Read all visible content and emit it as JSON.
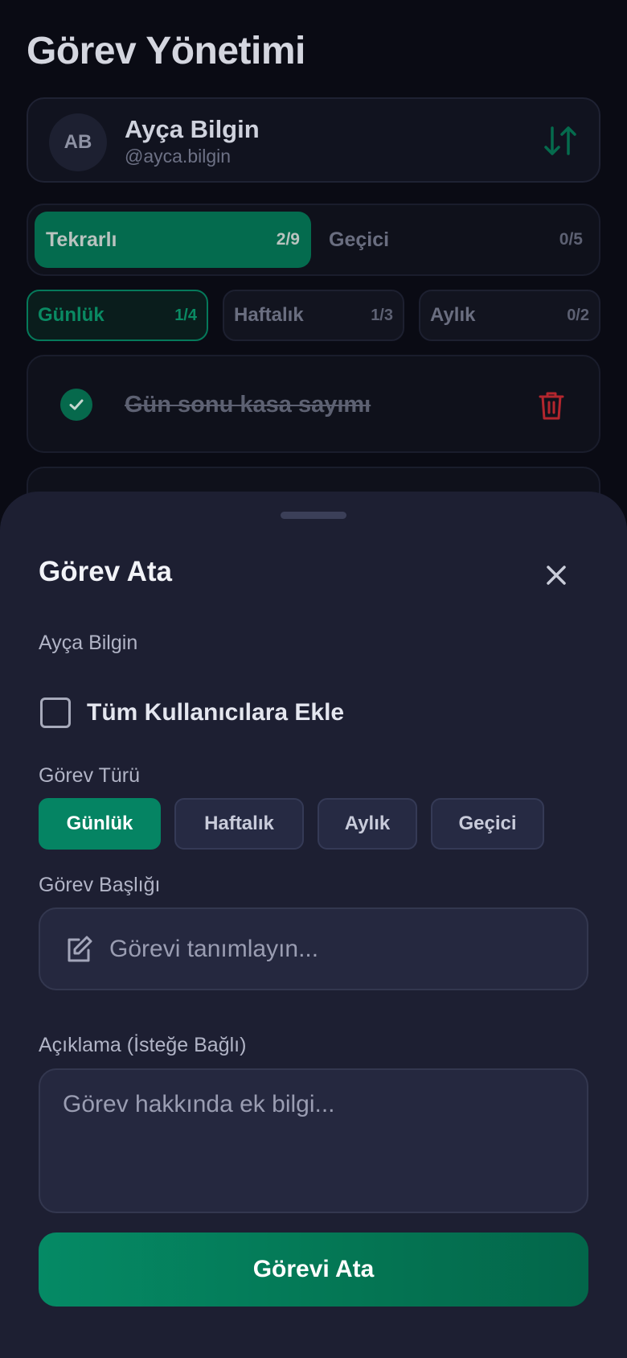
{
  "header": {
    "title": "Görev Yönetimi"
  },
  "user": {
    "initials": "AB",
    "name": "Ayça Bilgin",
    "handle": "@ayca.bilgin"
  },
  "segments": [
    {
      "label": "Tekrarlı",
      "count": "2/9",
      "active": true
    },
    {
      "label": "Geçici",
      "count": "0/5",
      "active": false
    }
  ],
  "frequency_tabs": [
    {
      "label": "Günlük",
      "count": "1/4",
      "active": true
    },
    {
      "label": "Haftalık",
      "count": "1/3",
      "active": false
    },
    {
      "label": "Aylık",
      "count": "0/2",
      "active": false
    }
  ],
  "tasks": [
    {
      "title": "Gün sonu kasa sayımı",
      "completed": true
    }
  ],
  "sheet": {
    "title": "Görev Ata",
    "assignee": "Ayça Bilgin",
    "all_users_label": "Tüm Kullanıcılara Ekle",
    "all_users_checked": false,
    "type_label": "Görev Türü",
    "types": [
      {
        "label": "Günlük",
        "selected": true
      },
      {
        "label": "Haftalık",
        "selected": false
      },
      {
        "label": "Aylık",
        "selected": false
      },
      {
        "label": "Geçici",
        "selected": false
      }
    ],
    "title_label": "Görev Başlığı",
    "title_placeholder": "Görevi tanımlayın...",
    "description_label": "Açıklama (İsteğe Bağlı)",
    "description_placeholder": "Görev hakkında ek bilgi...",
    "submit_label": "Görevi Ata"
  },
  "colors": {
    "accent": "#058463",
    "danger": "#b3262e",
    "sheet_bg": "#1d1f32",
    "page_bg": "#0a0b14"
  }
}
